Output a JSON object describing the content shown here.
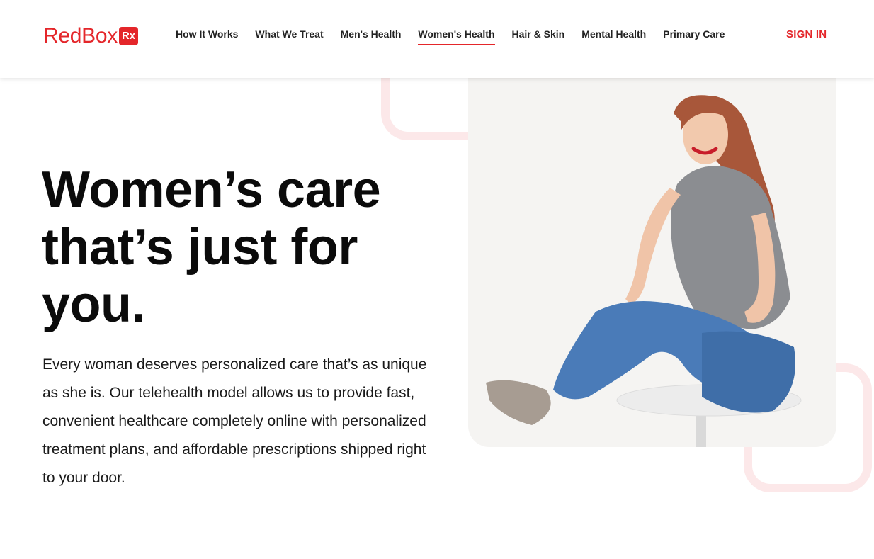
{
  "brand": {
    "name": "RedBox",
    "badge": "Rx"
  },
  "nav": {
    "items": [
      {
        "label": "How It Works"
      },
      {
        "label": "What We Treat"
      },
      {
        "label": "Men's Health"
      },
      {
        "label": "Women's Health",
        "active": true
      },
      {
        "label": "Hair & Skin"
      },
      {
        "label": "Mental Health"
      },
      {
        "label": "Primary Care"
      }
    ],
    "sign_in": "SIGN IN"
  },
  "hero": {
    "title": "Women’s care that’s just for you.",
    "body": "Every woman deserves personalized care that’s as unique as she is. Our telehealth model allows us to provide fast, convenient healthcare completely online with personalized treatment plans, and affordable prescriptions shipped right to your door."
  },
  "colors": {
    "brand_red": "#e4262a",
    "deco_pink": "#fce8e9",
    "photo_bg": "#f5f4f2"
  }
}
